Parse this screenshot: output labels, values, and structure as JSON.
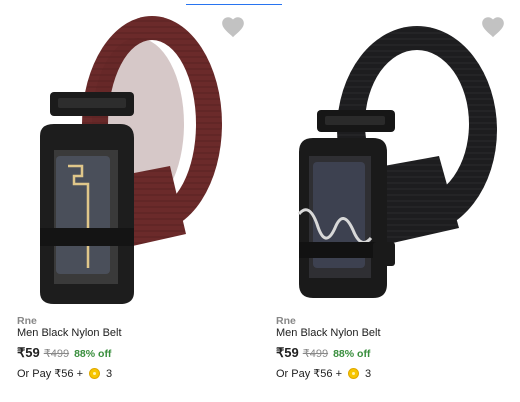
{
  "colors": {
    "price_text": "#212121",
    "mrp_text": "#878787",
    "discount_green": "#388e3c",
    "wishlist_heart": "#c2c2c2",
    "coin_gold": "#f7c600",
    "belt_brown": "#6b2a2a",
    "belt_black": "#1d1d1f"
  },
  "products": [
    {
      "brand": "Rne",
      "title": "Men Black Nylon Belt",
      "price": "₹59",
      "mrp": "₹499",
      "discount": "88% off",
      "pay_prefix": "Or Pay ₹56 +",
      "coins": "3",
      "image_alt": "brown nylon belt with black buckle",
      "wishlist_icon": "heart-icon"
    },
    {
      "brand": "Rne",
      "title": "Men Black Nylon Belt",
      "price": "₹59",
      "mrp": "₹499",
      "discount": "88% off",
      "pay_prefix": "Or Pay ₹56 +",
      "coins": "3",
      "image_alt": "black nylon belt with black buckle",
      "wishlist_icon": "heart-icon"
    }
  ]
}
